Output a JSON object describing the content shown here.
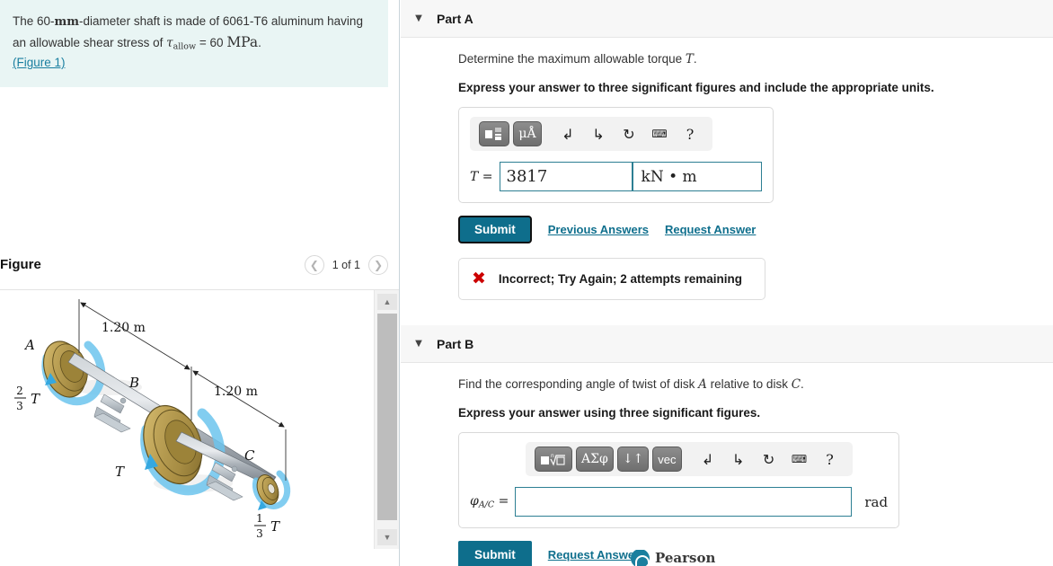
{
  "problem": {
    "text_part1": "The 60-",
    "mm": "mm",
    "text_part2": "-diameter shaft is made of 6061-T6 aluminum having an allowable shear stress of ",
    "tau_symbol": "τ",
    "tau_sub": "allow",
    "equals_value": " = 60 ",
    "mpa": "MPa",
    "period": ".",
    "figure_link": "(Figure 1)"
  },
  "figure": {
    "title": "Figure",
    "counter": "1 of 1",
    "prev_icon": "chevron-left-icon",
    "next_icon": "chevron-right-icon",
    "diagram": {
      "labels": {
        "A": "A",
        "B": "B",
        "C": "C",
        "dim1": "1.20 m",
        "dim2": "1.20 m",
        "torque_A_num": "2",
        "torque_A_den": "3",
        "torque_A_sym": "T",
        "torque_B_sym": "T",
        "torque_C_num": "1",
        "torque_C_den": "3",
        "torque_C_sym": "T"
      },
      "colors": {
        "pulley": "#b79a4c",
        "pulley_light": "#cdb469",
        "pulley_dark": "#8d7430",
        "shaft": "#a8adb3",
        "shaft_dark": "#7d848c",
        "arrow": "#5bbbe8",
        "bearing": "#b9c2c9"
      }
    },
    "scrollbar": {
      "up_icon": "triangle-up-icon",
      "down_icon": "triangle-down-icon"
    }
  },
  "partA": {
    "label": "Part A",
    "caret_icon": "caret-down-icon",
    "question": "Determine the maximum allowable torque ",
    "question_var": "T",
    "question_end": ".",
    "instruction": "Express your answer to three significant figures and include the appropriate units.",
    "toolbar": {
      "template_button": "template-icon",
      "units_button": "μÅ",
      "undo_icon": "undo-icon",
      "redo_icon": "redo-icon",
      "reset_icon": "reset-icon",
      "keyboard_icon": "keyboard-icon",
      "help_icon": "help-icon"
    },
    "var_label": "T =",
    "value": "3817",
    "units": "kN • m",
    "submit_label": "Submit",
    "previous_answers_label": "Previous Answers",
    "request_answer_label": "Request Answer",
    "feedback": {
      "icon": "x-mark-icon",
      "text": "Incorrect; Try Again; 2 attempts remaining"
    }
  },
  "partB": {
    "label": "Part B",
    "caret_icon": "caret-down-icon",
    "question_pre": "Find the corresponding angle of twist of disk ",
    "question_varA": "A",
    "question_mid": " relative to disk ",
    "question_varC": "C",
    "question_end": ".",
    "instruction": "Express your answer using three significant figures.",
    "toolbar": {
      "template_button": "radical-template-icon",
      "greek_button": "ΑΣφ",
      "arrows_button": "↓↑",
      "vec_button": "vec",
      "undo_icon": "undo-icon",
      "redo_icon": "redo-icon",
      "reset_icon": "reset-icon",
      "keyboard_icon": "keyboard-icon",
      "help_icon": "help-icon"
    },
    "var_label": "φ",
    "var_sub": "A/C",
    "var_eq": "=",
    "value": "",
    "units": "rad",
    "submit_label": "Submit",
    "request_answer_label": "Request Answer"
  },
  "branding": {
    "name": "Pearson",
    "logo_icon": "pearson-logo-icon"
  },
  "colors": {
    "problem_bg": "#e9f5f4",
    "accent": "#0e6e8c",
    "link": "#0f6f8d",
    "error": "#cc0000",
    "field_border": "#2d7f93"
  }
}
